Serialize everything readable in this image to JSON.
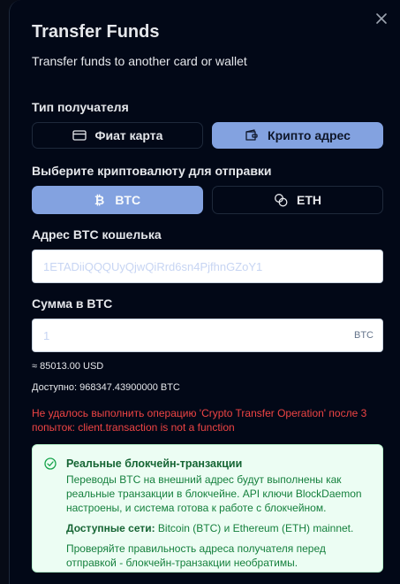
{
  "dialog": {
    "title": "Transfer Funds",
    "subtitle": "Transfer funds to another card or wallet"
  },
  "recipient": {
    "label": "Тип получателя",
    "options": [
      {
        "label": "Фиат карта",
        "icon": "credit-card-icon",
        "selected": false
      },
      {
        "label": "Крипто адрес",
        "icon": "wallet-icon",
        "selected": true
      }
    ]
  },
  "currency": {
    "label": "Выберите криптовалюту для отправки",
    "options": [
      {
        "label": "BTC",
        "icon": "bitcoin-icon",
        "selected": true
      },
      {
        "label": "ETH",
        "icon": "coins-icon",
        "selected": false
      }
    ]
  },
  "address": {
    "label": "Адрес BTC кошелька",
    "placeholder": "1ETADiiQQQUyQjwQiRrd6sn4PjfhnGZoY1",
    "value": ""
  },
  "amount": {
    "label": "Сумма в BTC",
    "placeholder": "1",
    "value": "",
    "unit": "BTC",
    "usd_equivalent": "≈ 85013.00 USD",
    "available": "Доступно: 968347.43900000 BTC"
  },
  "error": {
    "text": "Не удалось выполнить операцию 'Crypto Transfer Operation' после 3 попыток: client.transaction is not a function"
  },
  "notice": {
    "heading": "Реальные блокчейн-транзакции",
    "body": "Переводы BTC на внешний адрес будут выполнены как реальные транзакции в блокчейне. API ключи BlockDaemon настроены, и система готова к работе с блокчейном.",
    "networks_label": "Доступные сети:",
    "networks_value": " Bitcoin (BTC) и Ethereum (ETH) mainnet.",
    "warning": "Проверяйте правильность адреса получателя перед отправкой - блокчейн-транзакции необратимы."
  },
  "colors": {
    "background": "#020817",
    "accent": "#83a2e0",
    "error": "#ef4444",
    "success_bg": "#ecfdf3",
    "success_text": "#15803d"
  }
}
